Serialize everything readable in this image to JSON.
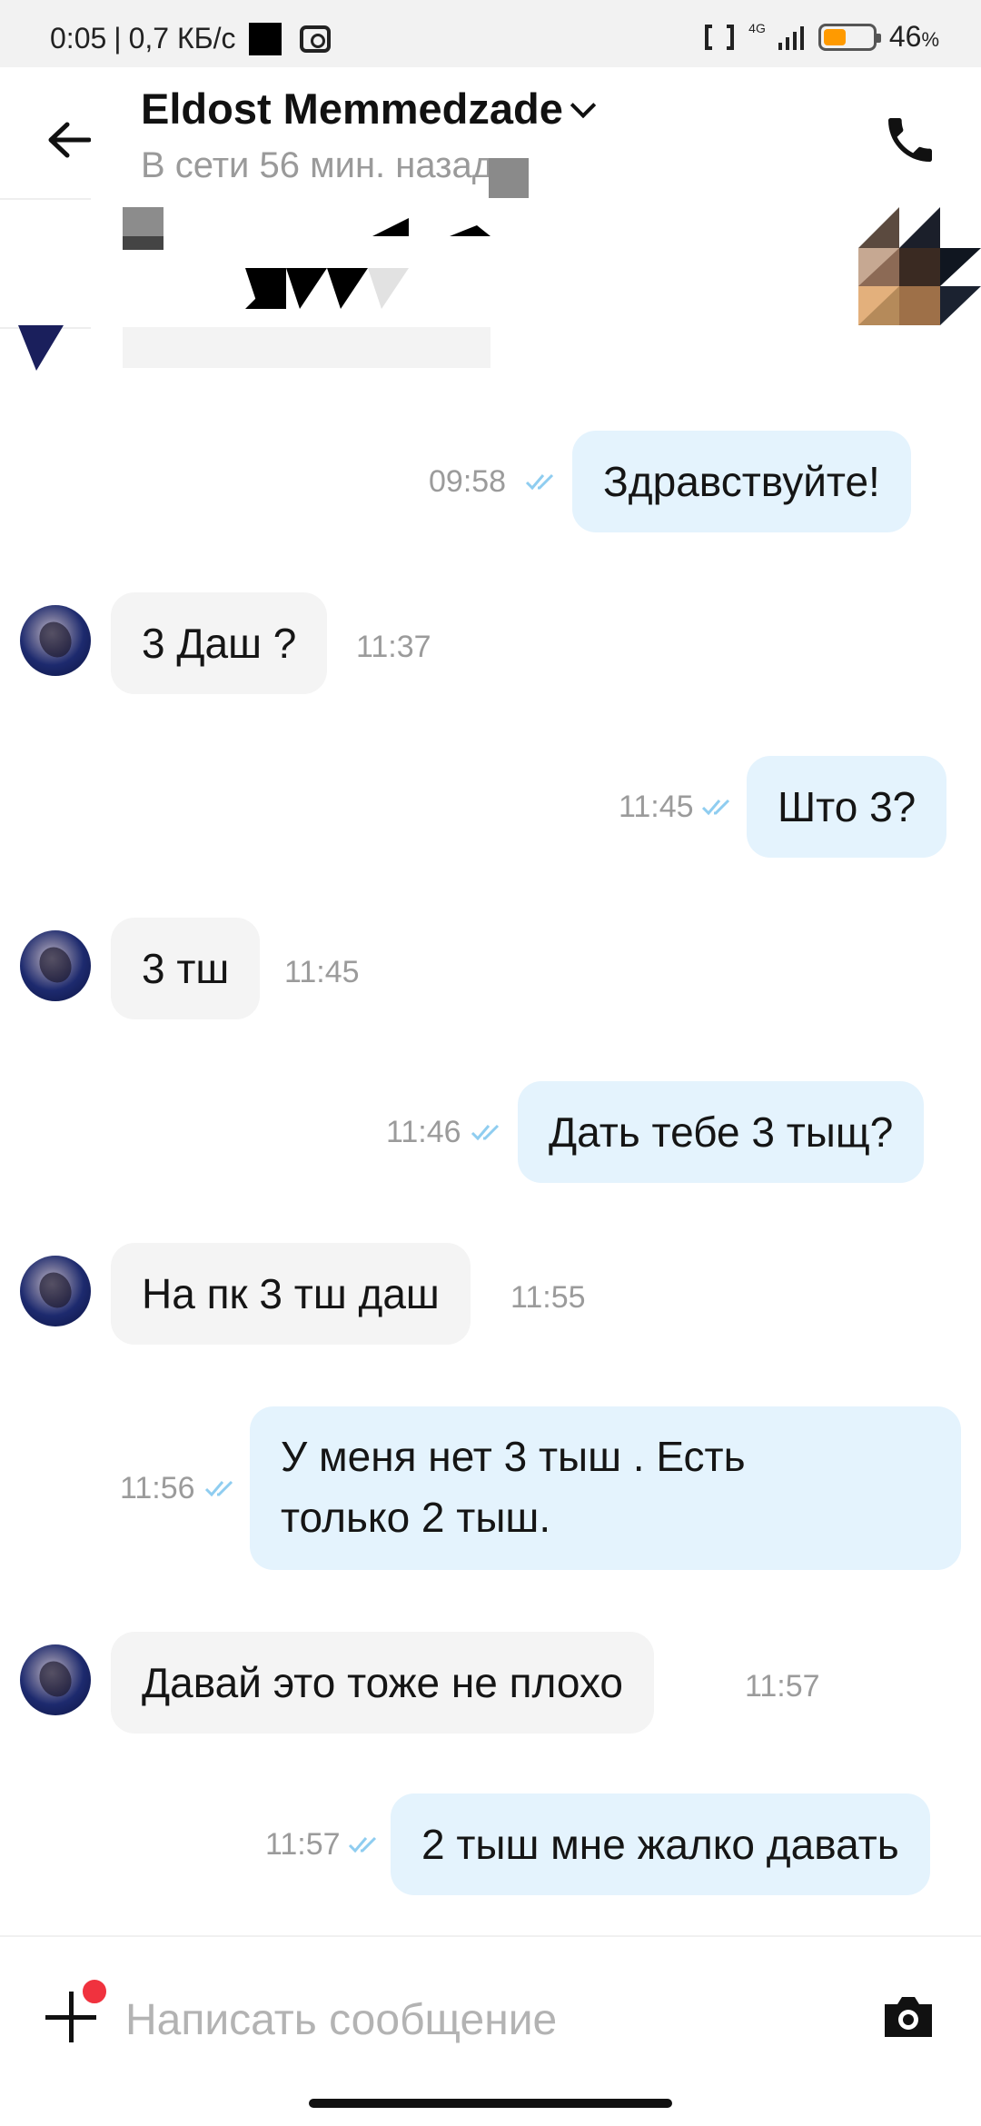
{
  "status_bar": {
    "time": "0:05",
    "network_speed": "0,7 КБ/с",
    "network_type": "4G",
    "battery_percent": "46",
    "battery_symbol": "%",
    "battery_level": 0.46,
    "battery_color": "#ff9a00"
  },
  "header": {
    "contact_name": "Eldost Memmedzade",
    "last_seen": "В сети 56 мин. назад",
    "back_icon": "arrow-left-icon",
    "call_icon": "phone-icon"
  },
  "messages": [
    {
      "direction": "out",
      "text": "Здравствуйте!",
      "time": "09:58",
      "status": "read"
    },
    {
      "direction": "in",
      "text": "3 Даш ?",
      "time": "11:37"
    },
    {
      "direction": "out",
      "text": "Што 3?",
      "time": "11:45",
      "status": "read"
    },
    {
      "direction": "in",
      "text": "3 тш",
      "time": "11:45"
    },
    {
      "direction": "out",
      "text": "Дать тебе 3 тыщ?",
      "time": "11:46",
      "status": "read"
    },
    {
      "direction": "in",
      "text": "На пк 3 тш даш",
      "time": "11:55"
    },
    {
      "direction": "out",
      "text": "У меня нет 3 тыш . Есть только 2 тыш.",
      "time": "11:56",
      "status": "read"
    },
    {
      "direction": "in",
      "text": "Давай это тоже не плохо",
      "time": "11:57"
    },
    {
      "direction": "out",
      "text": "2 тыш мне жалко давать",
      "time": "11:57",
      "status": "read"
    }
  ],
  "composer": {
    "placeholder": "Написать сообщение",
    "add_icon": "plus-icon",
    "camera_icon": "camera-icon"
  },
  "colors": {
    "outgoing_bubble": "#e4f3fd",
    "incoming_bubble": "#f4f4f4",
    "read_ticks": "#8fcdf0",
    "timestamp": "#9b9b9b"
  }
}
